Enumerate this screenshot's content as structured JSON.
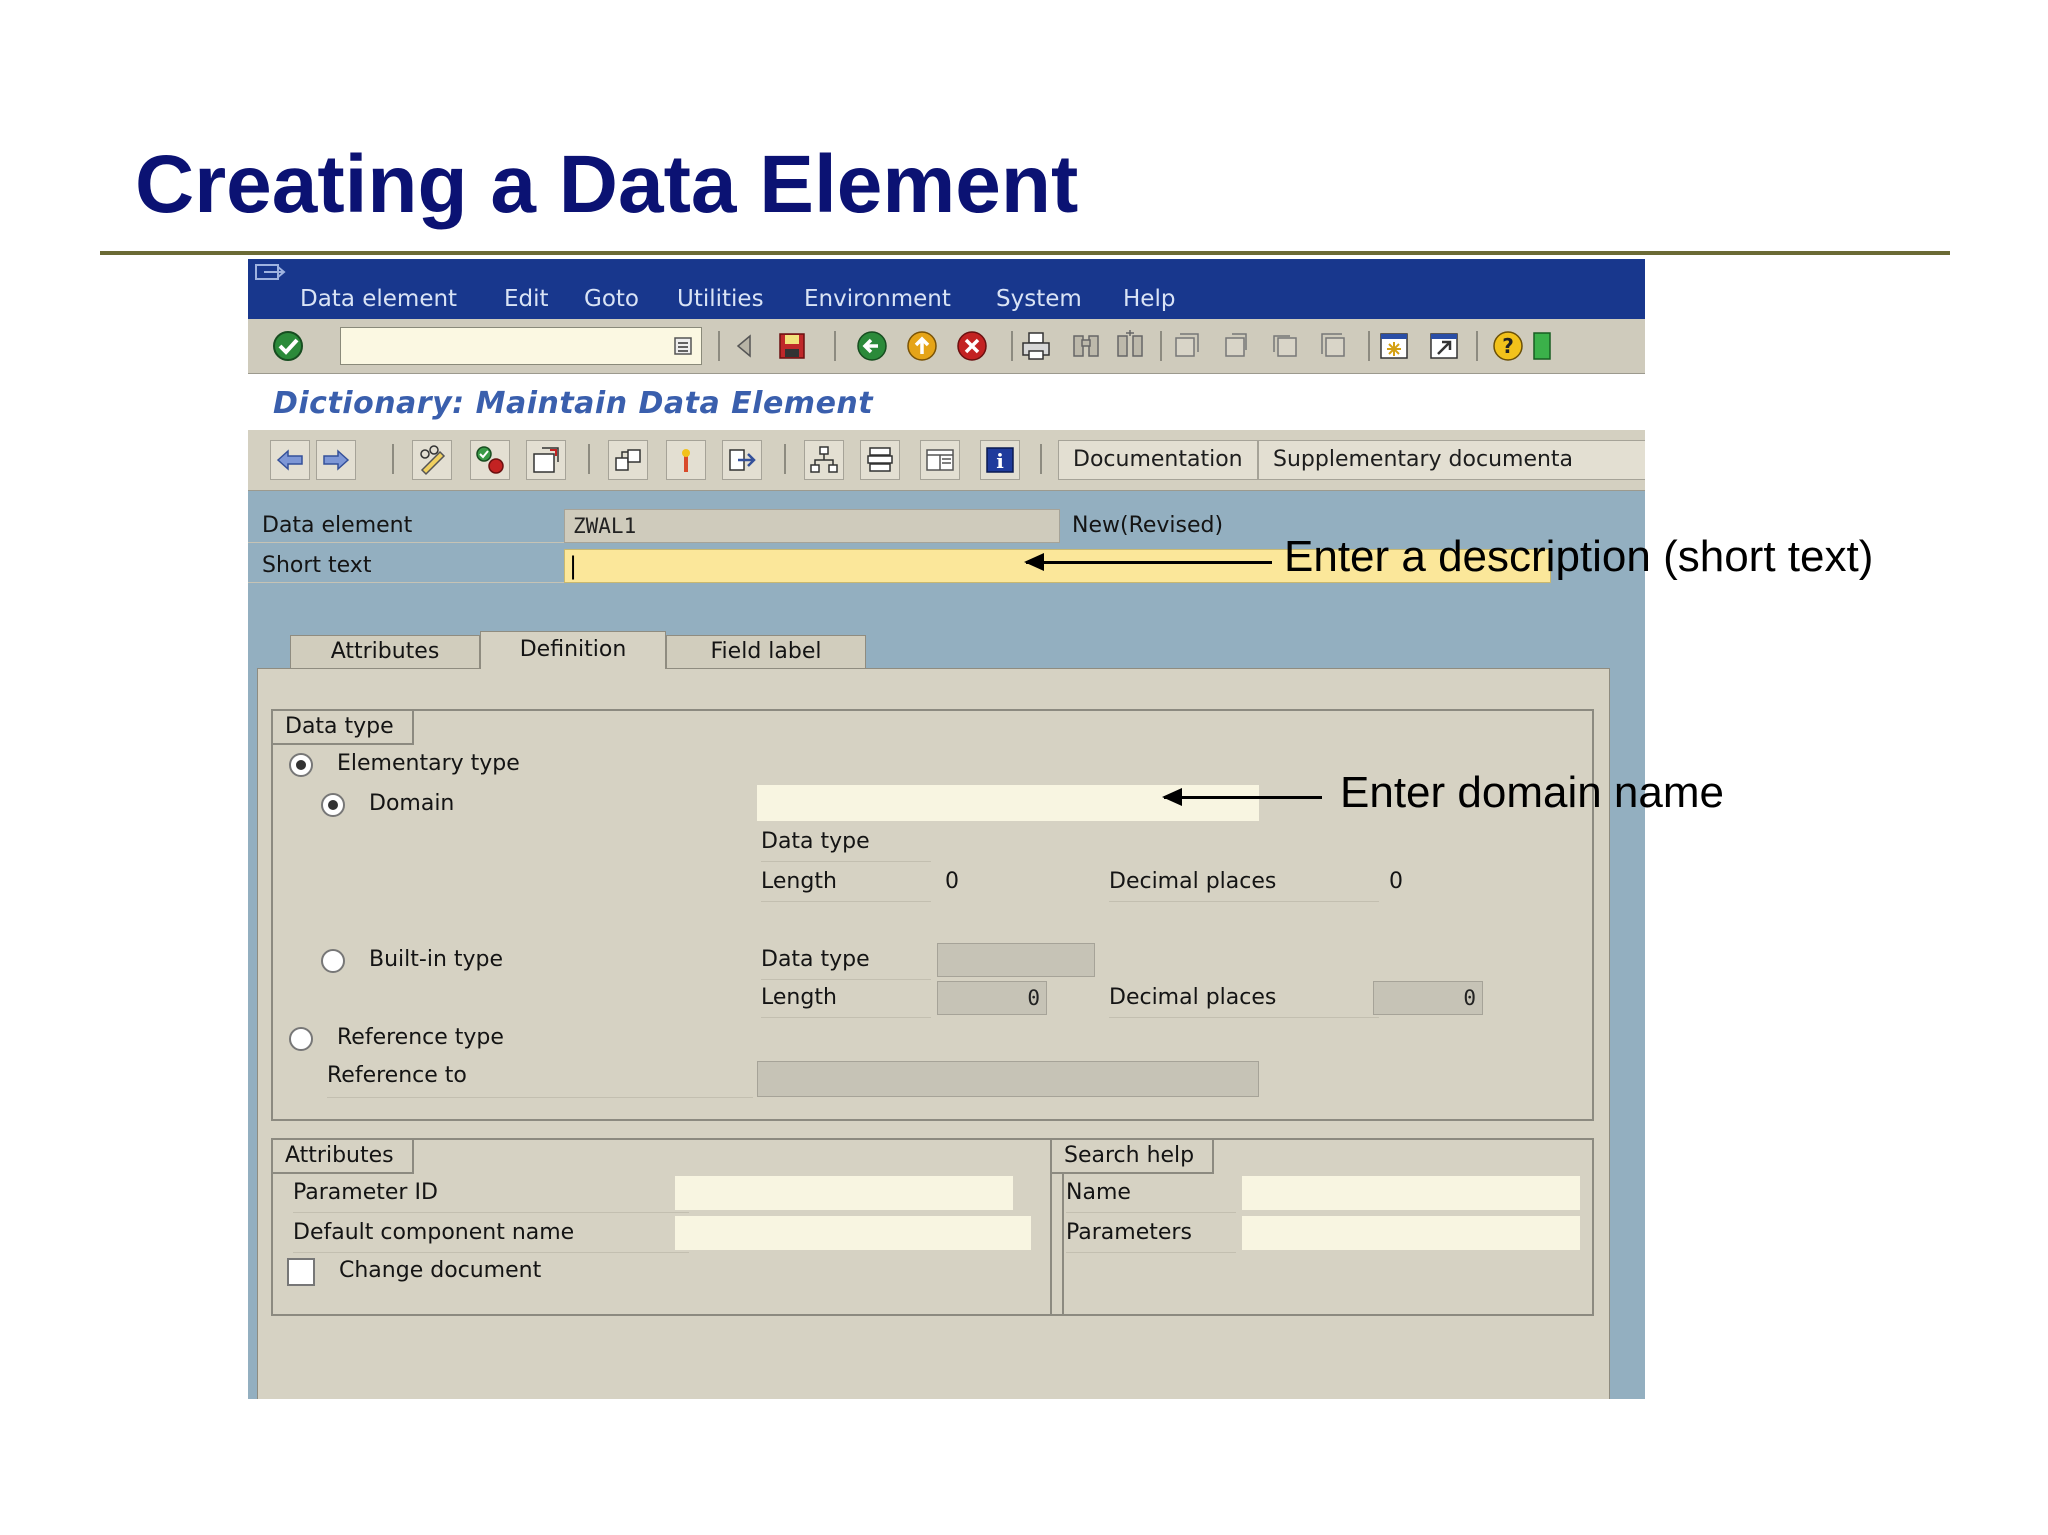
{
  "slide": {
    "title": "Creating a Data Element"
  },
  "menu": [
    "Data element",
    "Edit",
    "Goto",
    "Utilities",
    "Environment",
    "System",
    "Help"
  ],
  "screen_title": "Dictionary: Maintain Data Element",
  "app_toolbar": {
    "documentation": "Documentation",
    "supplementary": "Supplementary documenta"
  },
  "header": {
    "data_element_label": "Data element",
    "data_element_value": "ZWAL1",
    "status": "New(Revised)",
    "short_text_label": "Short text",
    "short_text_value": "|"
  },
  "tabs": [
    {
      "label": "Attributes"
    },
    {
      "label": "Definition",
      "active": true
    },
    {
      "label": "Field label"
    }
  ],
  "data_type_group": {
    "title": "Data type",
    "elementary": "Elementary type",
    "domain": "Domain",
    "data_type": "Data type",
    "length": "Length",
    "length_value": "0",
    "decimal_places": "Decimal places",
    "decimal_value": "0",
    "builtin": "Built-in type",
    "builtin_data_type": "Data type",
    "builtin_length": "Length",
    "builtin_length_value": "0",
    "builtin_decimal": "Decimal places",
    "builtin_decimal_value": "0",
    "reference_type": "Reference type",
    "reference_to": "Reference to"
  },
  "attributes_group": {
    "title": "Attributes",
    "parameter_id": "Parameter ID",
    "default_component": "Default component name",
    "change_document": "Change document"
  },
  "search_help_group": {
    "title": "Search help",
    "name": "Name",
    "parameters": "Parameters"
  },
  "annotations": {
    "short_text": "Enter a description (short text)",
    "domain": "Enter domain name"
  },
  "icons": [
    "enter-check-icon",
    "command-history-icon",
    "back-triangle-icon",
    "save-icon",
    "back-icon",
    "exit-icon",
    "cancel-icon",
    "print-icon",
    "find-icon",
    "find-next-icon",
    "first-page-icon",
    "previous-page-icon",
    "next-page-icon",
    "last-page-icon",
    "new-session-icon",
    "shortcut-icon",
    "help-icon",
    "layout-icon"
  ],
  "colors": {
    "menubar": "#18378d",
    "canvas": "#93afc0",
    "panel": "#d6d2c3",
    "title": "#0b1273",
    "highlight": "#fbe79a"
  }
}
